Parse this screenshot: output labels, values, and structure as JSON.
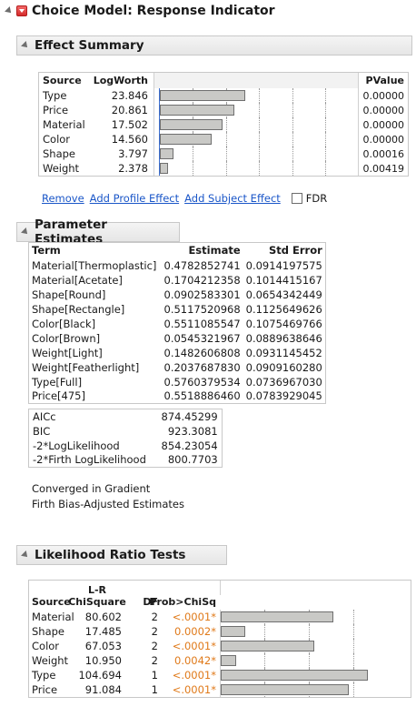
{
  "report": {
    "title": "Choice Model: Response Indicator"
  },
  "effect_summary": {
    "title": "Effect Summary",
    "headers": {
      "source": "Source",
      "logworth": "LogWorth",
      "pvalue": "PValue"
    },
    "rows": [
      {
        "source": "Type",
        "logworth": "23.846",
        "pvalue": "0.00000",
        "logworth_value": 23.846
      },
      {
        "source": "Price",
        "logworth": "20.861",
        "pvalue": "0.00000",
        "logworth_value": 20.861
      },
      {
        "source": "Material",
        "logworth": "17.502",
        "pvalue": "0.00000",
        "logworth_value": 17.502
      },
      {
        "source": "Color",
        "logworth": "14.560",
        "pvalue": "0.00000",
        "logworth_value": 14.56
      },
      {
        "source": "Shape",
        "logworth": "3.797",
        "pvalue": "0.00016",
        "logworth_value": 3.797
      },
      {
        "source": "Weight",
        "logworth": "2.378",
        "pvalue": "0.00419",
        "logworth_value": 2.378
      }
    ],
    "links": {
      "remove": "Remove",
      "add_profile": "Add Profile Effect",
      "add_subject": "Add Subject Effect",
      "fdr": "FDR"
    },
    "fdr_checked": false
  },
  "parameter_estimates": {
    "title": "Parameter Estimates",
    "headers": {
      "term": "Term",
      "estimate": "Estimate",
      "std_error": "Std Error"
    },
    "rows": [
      {
        "term": "Material[Thermoplastic]",
        "estimate": "0.4782852741",
        "std_error": "0.0914197575"
      },
      {
        "term": "Material[Acetate]",
        "estimate": "0.1704212358",
        "std_error": "0.1014415167"
      },
      {
        "term": "Shape[Round]",
        "estimate": "0.0902583301",
        "std_error": "0.0654342449"
      },
      {
        "term": "Shape[Rectangle]",
        "estimate": "0.5117520968",
        "std_error": "0.1125649626"
      },
      {
        "term": "Color[Black]",
        "estimate": "0.5511085547",
        "std_error": "0.1075469766"
      },
      {
        "term": "Color[Brown]",
        "estimate": "0.0545321967",
        "std_error": "0.0889638646"
      },
      {
        "term": "Weight[Light]",
        "estimate": "0.1482606808",
        "std_error": "0.0931145452"
      },
      {
        "term": "Weight[Featherlight]",
        "estimate": "0.2037687830",
        "std_error": "0.0909160280"
      },
      {
        "term": "Type[Full]",
        "estimate": "0.5760379534",
        "std_error": "0.0736967030"
      },
      {
        "term": "Price[475]",
        "estimate": "0.5518886460",
        "std_error": "0.0783929045"
      }
    ],
    "fit": [
      {
        "label": "AICc",
        "value": "874.45299"
      },
      {
        "label": "BIC",
        "value": "923.3081"
      },
      {
        "label": "-2*LogLikelihood",
        "value": "854.23054"
      },
      {
        "label": "-2*Firth LogLikelihood",
        "value": "800.7703"
      }
    ],
    "notes": {
      "converged": "Converged in Gradient",
      "firth": "Firth Bias-Adjusted Estimates"
    }
  },
  "likelihood_ratio": {
    "title": "Likelihood Ratio Tests",
    "headers": {
      "source": "Source",
      "lr_top": "L-R",
      "chisq": "ChiSquare",
      "df": "DF",
      "prob": "Prob>ChiSq"
    },
    "rows": [
      {
        "source": "Material",
        "chisq": "80.602",
        "df": "2",
        "prob": "<.0001*",
        "chisq_value": 80.602
      },
      {
        "source": "Shape",
        "chisq": "17.485",
        "df": "2",
        "prob": "0.0002*",
        "chisq_value": 17.485
      },
      {
        "source": "Color",
        "chisq": "67.053",
        "df": "2",
        "prob": "<.0001*",
        "chisq_value": 67.053
      },
      {
        "source": "Weight",
        "chisq": "10.950",
        "df": "2",
        "prob": "0.0042*",
        "chisq_value": 10.95
      },
      {
        "source": "Type",
        "chisq": "104.694",
        "df": "1",
        "prob": "<.0001*",
        "chisq_value": 104.694
      },
      {
        "source": "Price",
        "chisq": "91.084",
        "df": "1",
        "prob": "<.0001*",
        "chisq_value": 91.084
      }
    ]
  },
  "colors": {
    "significant_p": "#e07a1a",
    "link": "#1a56c8",
    "reference_line": "#3c6fd1"
  },
  "icons": {
    "collapse": "disclosure-triangle-icon",
    "menu": "red-triangle-menu-icon"
  }
}
